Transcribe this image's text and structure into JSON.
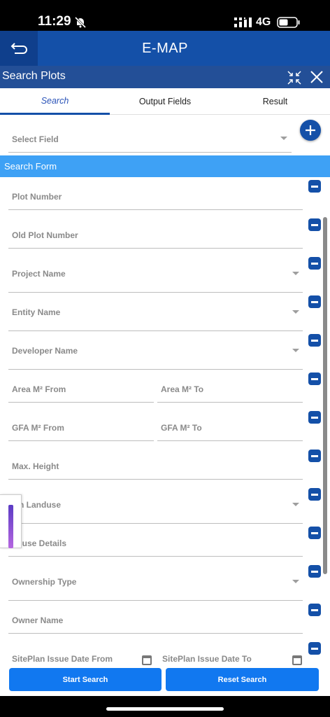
{
  "status_bar": {
    "time": "11:29",
    "network": "4G"
  },
  "header": {
    "title": "E-MAP"
  },
  "panel": {
    "title": "Search Plots"
  },
  "tabs": [
    {
      "label": "Search",
      "active": true
    },
    {
      "label": "Output Fields",
      "active": false
    },
    {
      "label": "Result",
      "active": false
    }
  ],
  "select_field": {
    "label": "Select Field"
  },
  "search_form": {
    "title": "Search Form",
    "fields": {
      "plot_number": "Plot Number",
      "old_plot_number": "Old Plot Number",
      "project_name": "Project Name",
      "entity_name": "Entity Name",
      "developer_name": "Developer Name",
      "area_from": "Area M² From",
      "area_to": "Area M² To",
      "gfa_from": "GFA M² From",
      "gfa_to": "GFA M² To",
      "max_height": "Max. Height",
      "main_landuse": "ain Landuse",
      "landuse_details": "nduse Details",
      "ownership_type": "Ownership Type",
      "owner_name": "Owner Name",
      "siteplan_from": "SitePlan Issue Date From",
      "siteplan_to": "SitePlan Issue Date To"
    }
  },
  "buttons": {
    "start": "Start Search",
    "reset": "Reset Search"
  },
  "colors": {
    "primary": "#1450a8",
    "form_header": "#3ea1f5",
    "button": "#1178f0"
  }
}
